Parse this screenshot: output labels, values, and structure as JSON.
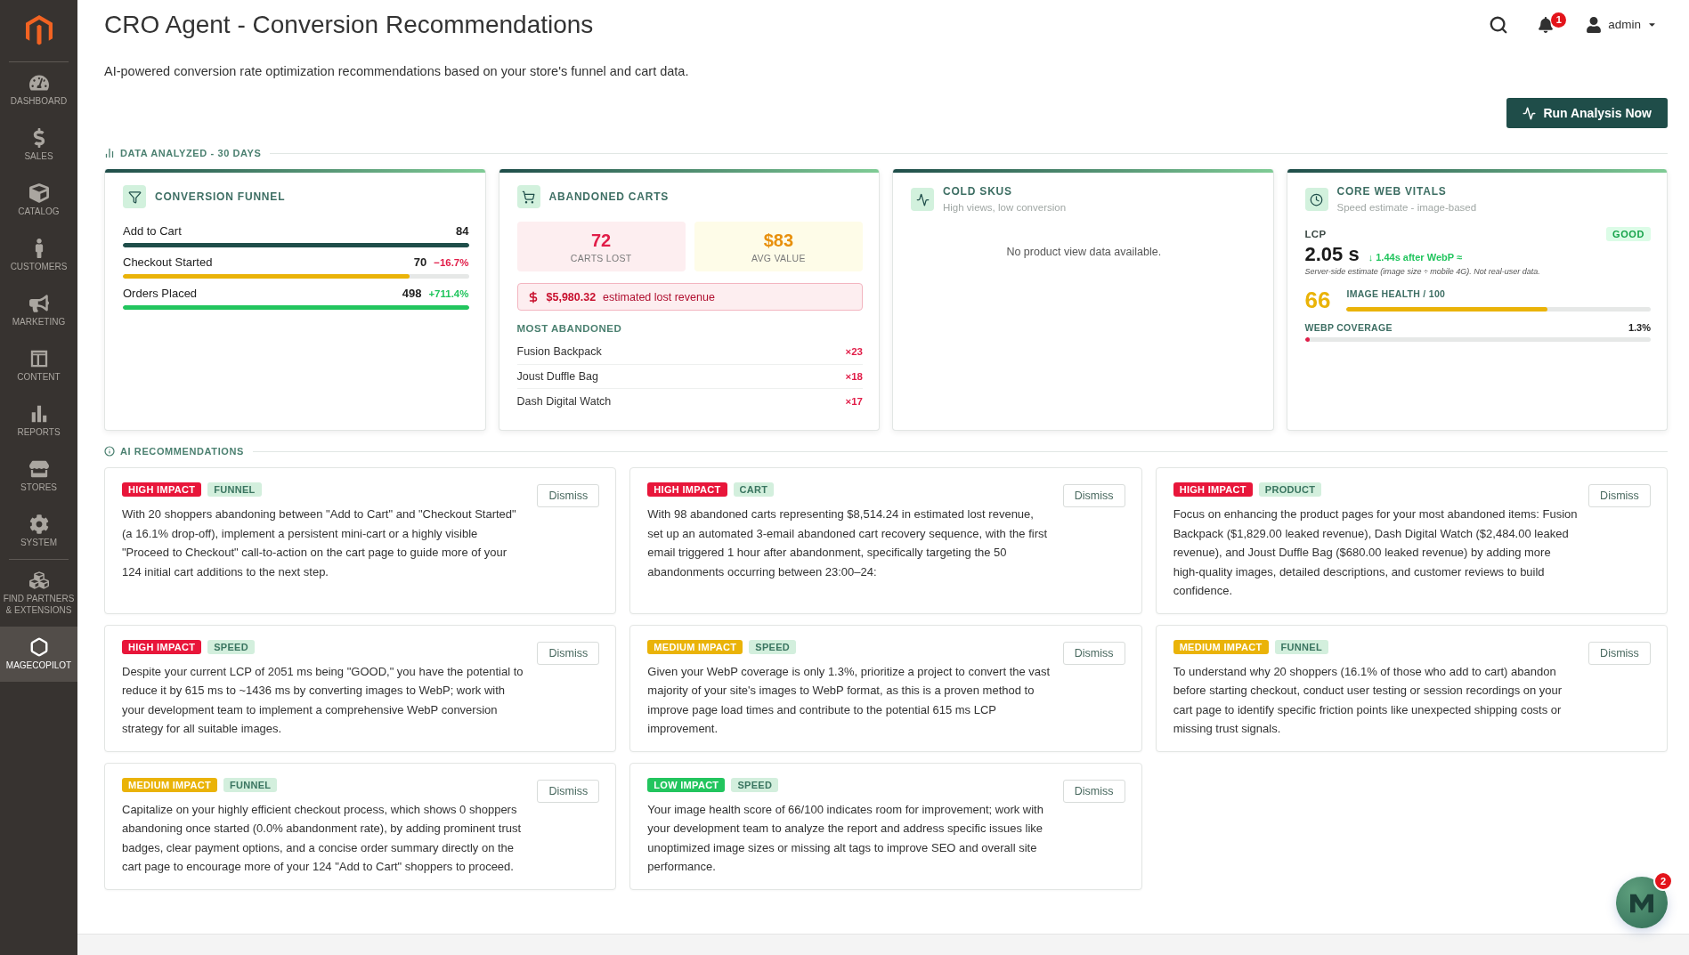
{
  "sidebar": {
    "sections": [
      {
        "items": [
          {
            "label": "DASHBOARD",
            "selected": false
          },
          {
            "label": "SALES",
            "selected": false
          },
          {
            "label": "CATALOG",
            "selected": false
          },
          {
            "label": "CUSTOMERS",
            "selected": false
          },
          {
            "label": "MARKETING",
            "selected": false
          },
          {
            "label": "CONTENT",
            "selected": false
          },
          {
            "label": "REPORTS",
            "selected": false
          },
          {
            "label": "STORES",
            "selected": false
          },
          {
            "label": "SYSTEM",
            "selected": false
          }
        ]
      },
      {
        "items": [
          {
            "label": "FIND PARTNERS & EXTENSIONS",
            "selected": false
          },
          {
            "label": "MAGECOPILOT",
            "selected": true
          }
        ]
      }
    ]
  },
  "header": {
    "title": "CRO Agent - Conversion Recommendations",
    "subtitle": "AI-powered conversion rate optimization recommendations based on your store's funnel and cart data.",
    "notifications": {
      "count": "1"
    },
    "user": {
      "name": "admin"
    }
  },
  "run_button": {
    "label": "Run Analysis Now"
  },
  "data_analyzed": {
    "title": "DATA ANALYZED - 30 DAYS",
    "funnel_card": {
      "title": "CONVERSION FUNNEL",
      "stages": [
        {
          "label": "Add to Cart",
          "value": "84",
          "level": 1,
          "color": "#1f4e4a"
        },
        {
          "label": "Checkout Started",
          "value": "70",
          "delta": "−16.7%",
          "negative": true,
          "level": 0.83,
          "color": "#eab308"
        },
        {
          "label": "Orders Placed",
          "value": "498",
          "delta": "+711.4%",
          "negative": false,
          "level": 1,
          "color": "#22c55e"
        }
      ]
    },
    "abandoned_carts_card": {
      "title": "ABANDONED CARTS",
      "stats": [
        {
          "kind": "loss",
          "value": "72",
          "label": "CARTS LOST"
        },
        {
          "kind": "value",
          "value": "$83",
          "label": "AVG VALUE"
        }
      ],
      "lost_revenue": {
        "amount": "$5,980.32",
        "label": "estimated lost revenue"
      },
      "most_abandoned": {
        "title": "MOST ABANDONED",
        "items": [
          {
            "name": "Fusion Backpack",
            "count": "×23"
          },
          {
            "name": "Joust Duffle Bag",
            "count": "×18"
          },
          {
            "name": "Dash Digital Watch",
            "count": "×17"
          }
        ]
      }
    },
    "cold_skus_card": {
      "title": "COLD SKUS",
      "subtitle": "High views, low conversion",
      "empty_message": "No product view data available."
    },
    "web_vitals_card": {
      "title": "CORE WEB VITALS",
      "subtitle": "Speed estimate - image-based",
      "lcp": {
        "label": "LCP",
        "rating": {
          "kind": "good",
          "label": "GOOD"
        },
        "value": "2.05 s",
        "projection": "↓ 1.44s after WebP ≈",
        "note": "Server-side estimate (image size ÷ mobile 4G). Not real-user data."
      },
      "image_health": {
        "score": "66",
        "label": "IMAGE HEALTH / 100",
        "level": 0.66
      },
      "webp_coverage": {
        "label": "WEBP COVERAGE",
        "value": "1.3%",
        "level": 0.013
      }
    }
  },
  "recommendations": {
    "title": "AI RECOMMENDATIONS",
    "items": [
      {
        "kind": "high",
        "impact_label": "HIGH IMPACT",
        "category": "FUNNEL",
        "text": "With 20 shoppers abandoning between \"Add to Cart\" and \"Checkout Started\" (a 16.1% drop-off), implement a persistent mini-cart or a highly visible \"Proceed to Checkout\" call-to-action on the cart page to guide more of your 124 initial cart additions to the next step.",
        "dismiss_label": "Dismiss"
      },
      {
        "kind": "high",
        "impact_label": "HIGH IMPACT",
        "category": "CART",
        "text": "With 98 abandoned carts representing $8,514.24 in estimated lost revenue, set up an automated 3-email abandoned cart recovery sequence, with the first email triggered 1 hour after abandonment, specifically targeting the 50 abandonments occurring between 23:00–24:",
        "dismiss_label": "Dismiss"
      },
      {
        "kind": "high",
        "impact_label": "HIGH IMPACT",
        "category": "PRODUCT",
        "text": "Focus on enhancing the product pages for your most abandoned items: Fusion Backpack ($1,829.00 leaked revenue), Dash Digital Watch ($2,484.00 leaked revenue), and Joust Duffle Bag ($680.00 leaked revenue) by adding more high-quality images, detailed descriptions, and customer reviews to build confidence.",
        "dismiss_label": "Dismiss"
      },
      {
        "kind": "high",
        "impact_label": "HIGH IMPACT",
        "category": "SPEED",
        "text": "Despite your current LCP of 2051 ms being \"GOOD,\" you have the potential to reduce it by 615 ms to ~1436 ms by converting images to WebP; work with your development team to implement a comprehensive WebP conversion strategy for all suitable images.",
        "dismiss_label": "Dismiss"
      },
      {
        "kind": "medium",
        "impact_label": "MEDIUM IMPACT",
        "category": "SPEED",
        "text": "Given your WebP coverage is only 1.3%, prioritize a project to convert the vast majority of your site's images to WebP format, as this is a proven method to improve page load times and contribute to the potential 615 ms LCP improvement.",
        "dismiss_label": "Dismiss"
      },
      {
        "kind": "medium",
        "impact_label": "MEDIUM IMPACT",
        "category": "FUNNEL",
        "text": "To understand why 20 shoppers (16.1% of those who add to cart) abandon before starting checkout, conduct user testing or session recordings on your cart page to identify specific friction points like unexpected shipping costs or missing trust signals.",
        "dismiss_label": "Dismiss"
      },
      {
        "kind": "medium",
        "impact_label": "MEDIUM IMPACT",
        "category": "FUNNEL",
        "text": "Capitalize on your highly efficient checkout process, which shows 0 shoppers abandoning once started (0.0% abandonment rate), by adding prominent trust badges, clear payment options, and a concise order summary directly on the cart page to encourage more of your 124 \"Add to Cart\" shoppers to proceed.",
        "dismiss_label": "Dismiss"
      },
      {
        "kind": "low",
        "impact_label": "LOW IMPACT",
        "category": "SPEED",
        "text": "Your image health score of 66/100 indicates room for improvement; work with your development team to analyze the report and address specific issues like unoptimized image sizes or missing alt tags to improve SEO and overall site performance.",
        "dismiss_label": "Dismiss"
      }
    ]
  },
  "chat_widget": {
    "badge": "2"
  }
}
